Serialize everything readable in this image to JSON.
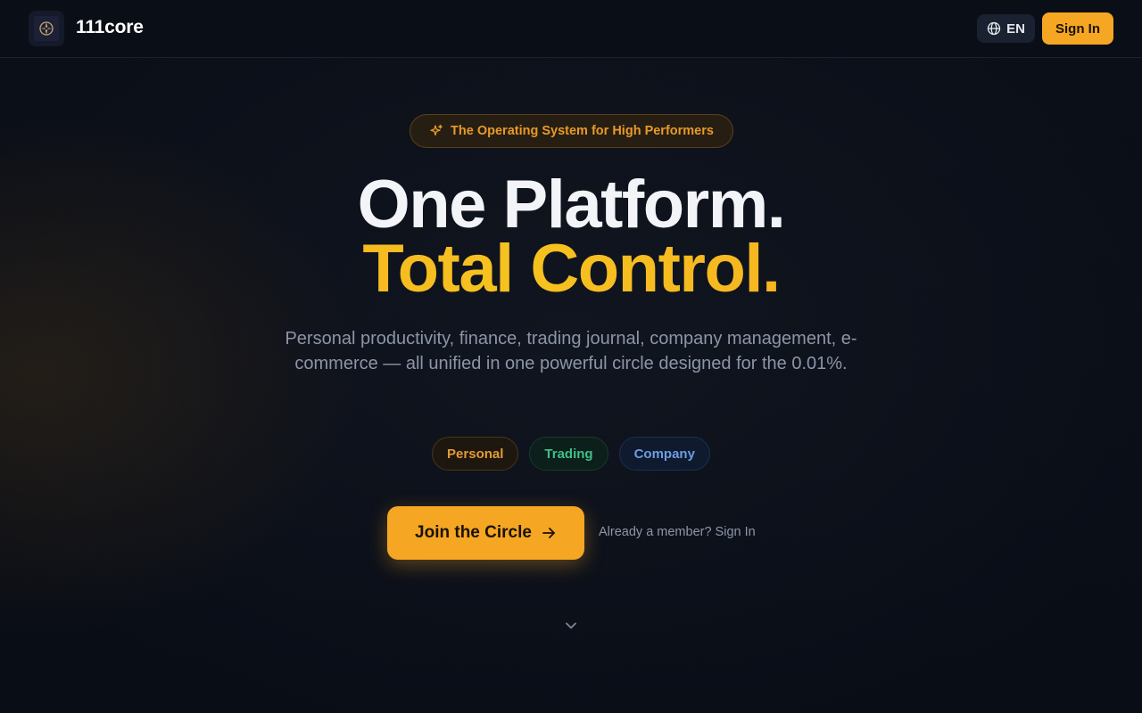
{
  "brand": {
    "name": "111core"
  },
  "header": {
    "language_label": "EN",
    "signin_label": "Sign In"
  },
  "hero": {
    "badge_text": "The Operating System for High Performers",
    "title_line1": "One Platform.",
    "title_line2": "Total Control.",
    "subtitle": "Personal productivity, finance, trading journal, company management, e-commerce — all unified in one powerful circle designed for the 0.01%.",
    "pills": [
      {
        "label": "Personal"
      },
      {
        "label": "Trading"
      },
      {
        "label": "Company"
      }
    ],
    "cta_label": "Join the Circle",
    "member_link": "Already a member? Sign In"
  },
  "icons": {
    "logo": "compass-emblem-icon",
    "language": "globe-icon",
    "badge": "sparkles-icon",
    "cta": "arrow-right-icon",
    "scroll": "chevron-down-icon"
  },
  "colors": {
    "accent": "#f5a623",
    "accent_gradient_mid": "#f6c21f",
    "background": "#0a0e17",
    "personal": "#e39a35",
    "trading": "#3fbf8a",
    "company": "#6e9be2",
    "muted_text": "#8c95a8"
  }
}
